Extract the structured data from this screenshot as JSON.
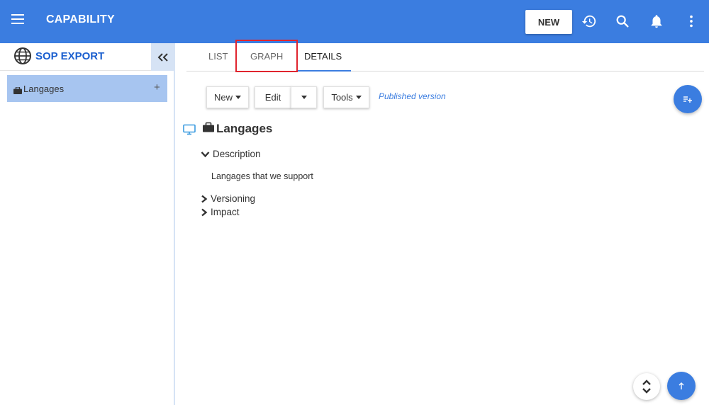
{
  "header": {
    "title": "CAPABILITY",
    "new_label": "NEW"
  },
  "sidebar": {
    "title": "SOP EXPORT",
    "items": [
      {
        "label": "Langages",
        "add": "+"
      }
    ]
  },
  "tabs": [
    {
      "label": "LIST"
    },
    {
      "label": "GRAPH"
    },
    {
      "label": "DETAILS"
    }
  ],
  "toolbar": {
    "new_label": "New",
    "edit_label": "Edit",
    "tools_label": "Tools",
    "status": "Published version"
  },
  "detail": {
    "title": "Langages",
    "sections": [
      {
        "label": "Description",
        "expanded": true,
        "content": "Langages that we support"
      },
      {
        "label": "Versioning",
        "expanded": false
      },
      {
        "label": "Impact",
        "expanded": false
      }
    ]
  },
  "colors": {
    "primary": "#3b7de0",
    "sidebar_selected": "#a7c5f0",
    "highlight": "#e0242e"
  }
}
